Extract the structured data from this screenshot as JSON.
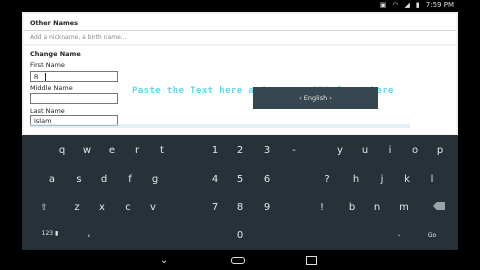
{
  "status": {
    "time": "7:59",
    "am_pm": "PM",
    "icon_names": [
      "image-icon",
      "sync-icon",
      "usb-icon",
      "wifi-icon",
      "signal-icon",
      "battery-icon"
    ]
  },
  "other_names": {
    "title": "Other Names",
    "nickname_placeholder": "Add a nickname, a birth name..."
  },
  "change_name": {
    "title": "Change Name",
    "first_label": "First Name",
    "first_value": "R",
    "middle_label": "Middle Name",
    "middle_value": "",
    "last_label": "Last Name",
    "last_value": "Islam"
  },
  "instruction": "Paste the Text here and remove \"R\" from there",
  "keyboard": {
    "row1": [
      "q",
      "w",
      "e",
      "r",
      "t",
      "y",
      "u",
      "i",
      "o",
      "p",
      "1",
      "2",
      "3",
      "-",
      "y",
      "u",
      "i",
      "o",
      "p"
    ],
    "row2": [
      "a",
      "s",
      "d",
      "f",
      "g",
      "4",
      "5",
      "6",
      "?",
      "h",
      "j",
      "k",
      "l"
    ],
    "row3": [
      "z",
      "x",
      "c",
      "v",
      "7",
      "8",
      "9",
      "!",
      "b",
      "n",
      "m"
    ],
    "shift_icon": "shift-icon",
    "mode_key": "123",
    "mic_icon": "mic-icon",
    "zero_key": "0",
    "comma_key": ",",
    "period_key": ".",
    "space_label": "‹ English ›",
    "go_label": "Go",
    "delete_icon": "backspace-icon"
  },
  "nav": {
    "icons": [
      "back-icon",
      "home-icon",
      "recent-apps-icon"
    ]
  }
}
